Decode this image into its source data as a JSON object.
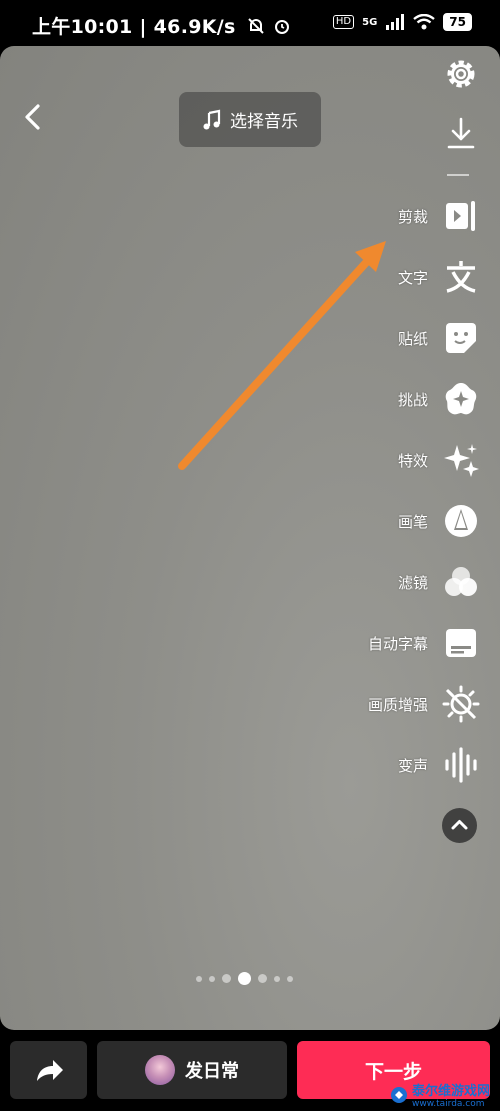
{
  "status_bar": {
    "left_text": "上午10:01 | 46.9K/s",
    "hd": "HD",
    "network": "5G",
    "battery": "75"
  },
  "top": {
    "music_label": "选择音乐"
  },
  "tools": [
    {
      "label": "",
      "icon": "gear-icon"
    },
    {
      "label": "",
      "icon": "download-icon"
    },
    {
      "label": "剪裁",
      "icon": "trim-icon"
    },
    {
      "label": "文字",
      "icon": "text-icon"
    },
    {
      "label": "贴纸",
      "icon": "sticker-icon"
    },
    {
      "label": "挑战",
      "icon": "challenge-icon"
    },
    {
      "label": "特效",
      "icon": "sparkle-icon"
    },
    {
      "label": "画笔",
      "icon": "brush-icon"
    },
    {
      "label": "滤镜",
      "icon": "filter-icon"
    },
    {
      "label": "自动字幕",
      "icon": "subtitle-icon"
    },
    {
      "label": "画质增强",
      "icon": "enhance-icon"
    },
    {
      "label": "变声",
      "icon": "voice-icon"
    }
  ],
  "pager": {
    "count": 7,
    "active_index": 3
  },
  "bottom": {
    "daily_label": "发日常",
    "next_label": "下一步"
  },
  "watermark": {
    "site_name": "泰尔维游戏网",
    "site_url": "www.tairda.com"
  },
  "colors": {
    "accent": "#fe2c55",
    "annotation_arrow": "#f0892e"
  }
}
